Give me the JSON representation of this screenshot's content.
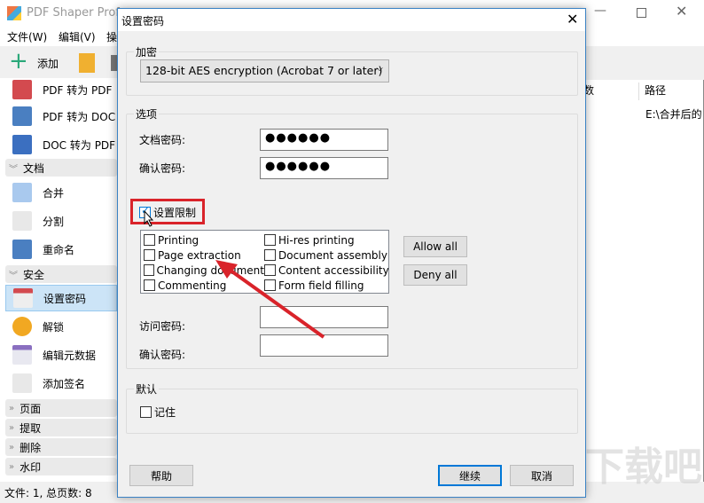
{
  "app": {
    "title": "PDF Shaper Profe",
    "menu": [
      "文件(W)",
      "编辑(V)",
      "操"
    ],
    "toolbar": {
      "add": "添加"
    },
    "sidebar": {
      "top_items": [
        "PDF 转为 PDF",
        "PDF 转为 DOC",
        "DOC 转为 PDF"
      ],
      "sections": [
        {
          "label": "文档",
          "items": [
            "合并",
            "分割",
            "重命名"
          ]
        },
        {
          "label": "安全",
          "items": [
            "设置密码",
            "解锁",
            "编辑元数据",
            "添加签名"
          ]
        },
        {
          "label": "页面"
        },
        {
          "label": "提取"
        },
        {
          "label": "删除"
        },
        {
          "label": "水印"
        }
      ]
    },
    "columns": [
      "数",
      "路径"
    ],
    "row_path": "E:\\合并后的",
    "status": "文件: 1, 总页数: 8"
  },
  "dialog": {
    "title": "设置密码",
    "encryption": {
      "label": "加密",
      "selected": "128-bit AES encryption (Acrobat 7 or later)"
    },
    "options": {
      "label": "选项",
      "doc_password_label": "文档密码:",
      "doc_password": "●●●●●●",
      "confirm_label": "确认密码:",
      "confirm_password": "●●●●●●",
      "restrict_label": "设置限制",
      "restrict_checked": true,
      "permissions_left": [
        "Printing",
        "Page extraction",
        "Changing document",
        "Commenting"
      ],
      "permissions_right": [
        "Hi-res printing",
        "Document assembly",
        "Content accessibility",
        "Form field filling"
      ],
      "allow_all": "Allow all",
      "deny_all": "Deny all",
      "access_password_label": "访问密码:",
      "access_confirm_label": "确认密码:"
    },
    "default": {
      "label": "默认",
      "remember": "记住"
    },
    "buttons": {
      "help": "帮助",
      "continue": "继续",
      "cancel": "取消"
    }
  },
  "colors": {
    "accent": "#0078d7",
    "highlight": "#d9232a"
  }
}
